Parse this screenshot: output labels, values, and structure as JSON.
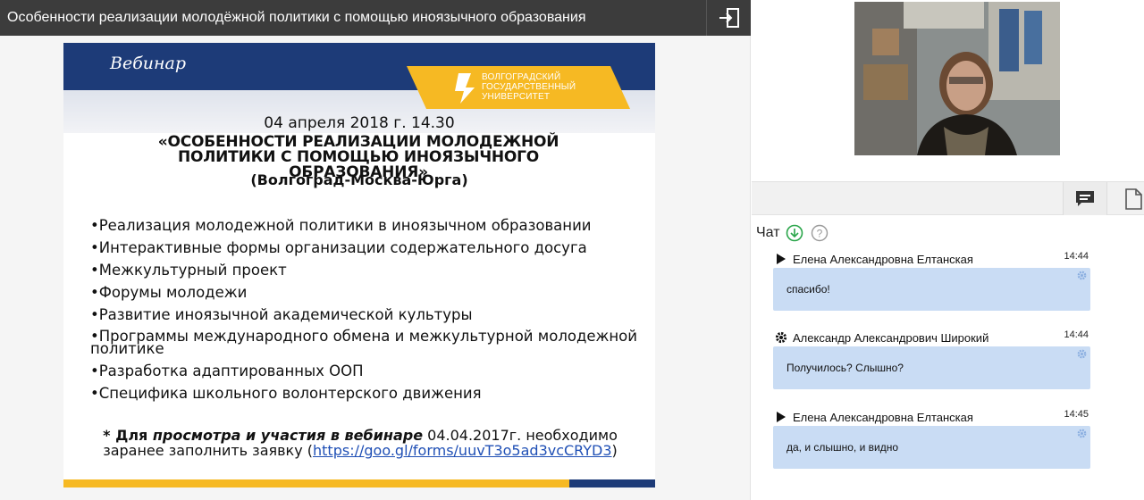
{
  "window": {
    "title": "Особенности реализации молодёжной политики с помощью иноязычного образования"
  },
  "slide": {
    "header_label": "Вебинар",
    "logo_lines": [
      "ВОЛГОГРАДСКИЙ",
      "ГОСУДАРСТВЕННЫЙ",
      "УНИВЕРСИТЕТ"
    ],
    "date": "04 апреля 2018 г. 14.30",
    "heading": "«ОСОБЕННОСТИ РЕАЛИЗАЦИИ МОЛОДЕЖНОЙ ПОЛИТИКИ С ПОМОЩЬЮ ИНОЯЗЫЧНОГО ОБРАЗОВАНИЯ»",
    "cities": "(Волгоград-Москва-Юрга)",
    "bullets": [
      "•Реализация молодежной политики в иноязычном образовании",
      "•Интерактивные формы организации содержательного досуга",
      "•Межкультурный проект",
      "•Форумы молодежи",
      "•Развитие иноязычной академической культуры",
      "•Программы международного обмена и межкультурной молодежной политике",
      "•Разработка адаптированных ООП",
      "•Специфика школьного волонтерского движения"
    ],
    "note": {
      "star": "* Для ",
      "emph": "просмотра и участия в вебинаре",
      "rest": " 04.04.2017г. необходимо заранее заполнить заявку (",
      "link": "https://goo.gl/forms/uuvT3o5ad3vcCRYD3",
      "close": ")"
    },
    "colors": {
      "navy": "#1d3b78",
      "gold": "#f6b923"
    }
  },
  "chat": {
    "label": "Чат",
    "messages": [
      {
        "author": "Елена Александровна Елтанская",
        "time": "14:44",
        "text": "спасибо!",
        "marker": "play-icon"
      },
      {
        "author": "Александр Александрович Широкий",
        "time": "14:44",
        "text": "Получилось? Слышно?",
        "marker": "gear-icon"
      },
      {
        "author": "Елена Александровна Елтанская",
        "time": "14:45",
        "text": "да, и слышно, и видно",
        "marker": "play-icon"
      }
    ],
    "bubble_color": "#c9dcf4"
  }
}
